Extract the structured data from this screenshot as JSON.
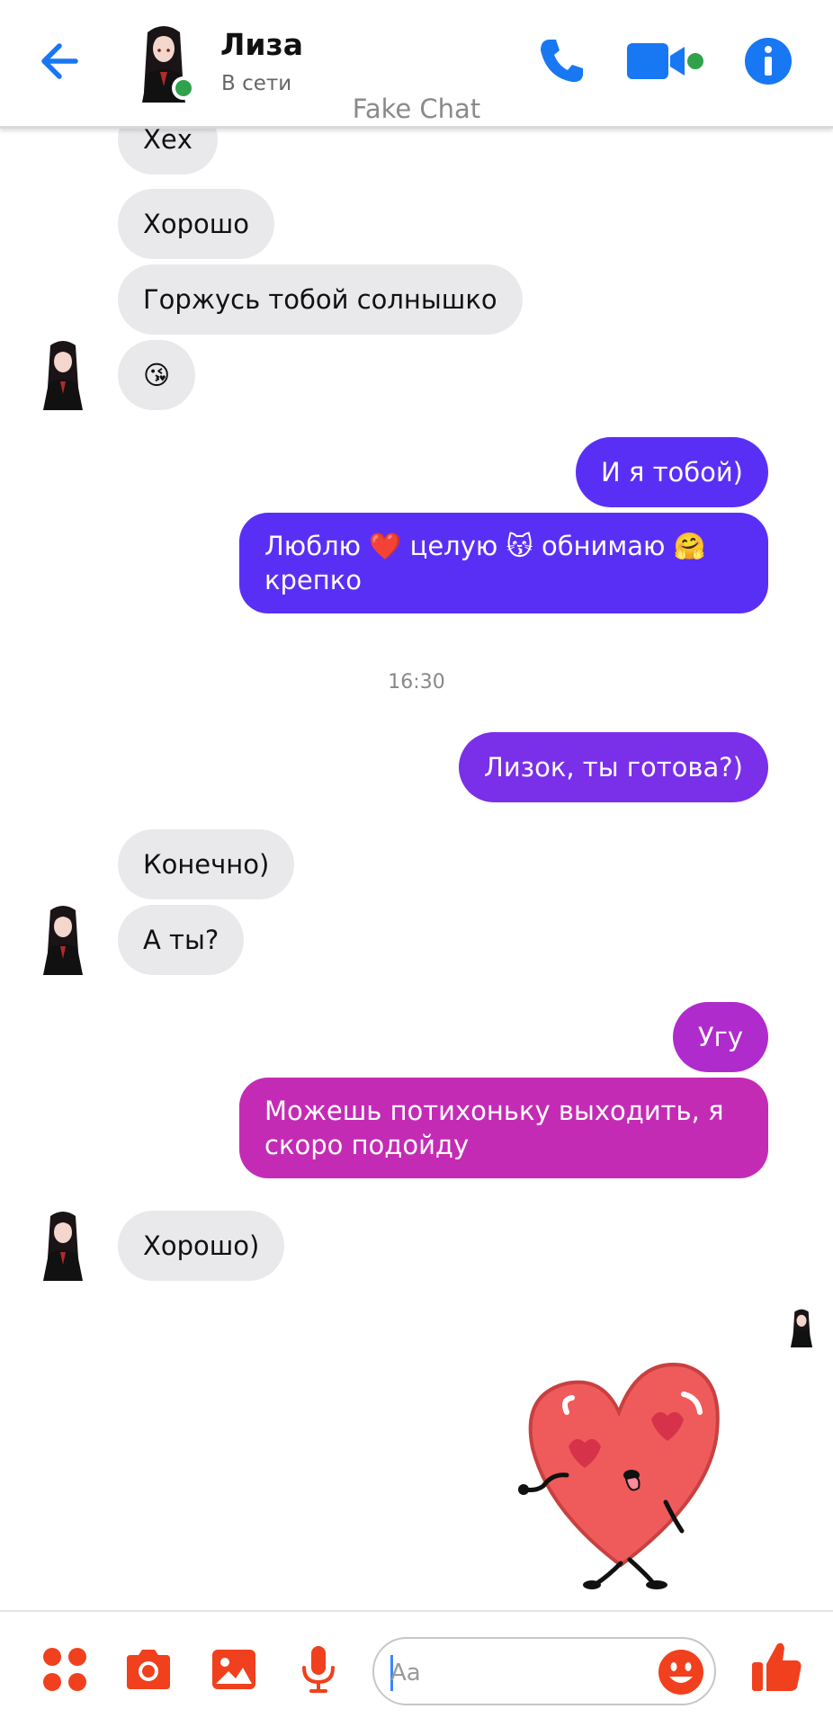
{
  "header": {
    "contact_name": "Лиза",
    "status": "В сети",
    "watermark": "Fake Chat",
    "back_icon": "back-arrow-icon",
    "call_icon": "phone-icon",
    "video_icon": "video-camera-icon",
    "info_icon": "info-icon"
  },
  "colors": {
    "accent": "#1877f2",
    "incoming_bubble": "#e9e9eb",
    "out_bubble_1": "#5a2ff5",
    "out_bubble_2": "#7a2fe8",
    "out_bubble_3": "#c42bb5",
    "footer_icons": "#f0401d",
    "online": "#31a24c"
  },
  "messages": [
    {
      "side": "in",
      "text": "Хех"
    },
    {
      "side": "in",
      "text": "Хорошо"
    },
    {
      "side": "in",
      "text": "Горжусь тобой солнышко"
    },
    {
      "side": "in",
      "text": "😘"
    },
    {
      "side": "out",
      "text": "И я тобой)"
    },
    {
      "side": "out",
      "text": "Люблю ❤️ целую 😽 обнимаю 🤗 крепко"
    },
    {
      "side": "time",
      "text": "16:30"
    },
    {
      "side": "out",
      "text": "Лизок, ты готова?)"
    },
    {
      "side": "in",
      "text": "Конечно)"
    },
    {
      "side": "in",
      "text": "А ты?"
    },
    {
      "side": "out",
      "text": "Угу"
    },
    {
      "side": "out",
      "text": "Можешь потихоньку выходить, я скоро подойду"
    },
    {
      "side": "in",
      "text": "Хорошо)"
    },
    {
      "side": "out",
      "type": "sticker",
      "sticker": "running-heart-sticker"
    }
  ],
  "footer": {
    "input_placeholder": "Aa",
    "icons": [
      "apps-icon",
      "camera-icon",
      "gallery-icon",
      "microphone-icon",
      "emoji-icon",
      "thumbs-up-icon"
    ]
  }
}
